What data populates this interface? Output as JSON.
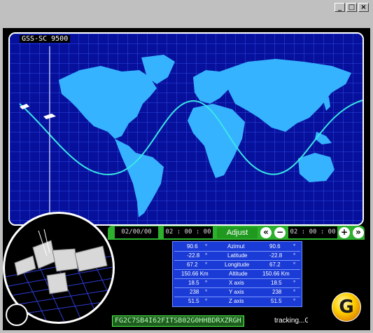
{
  "window": {
    "buttons": [
      "minimize",
      "maximize",
      "close"
    ]
  },
  "map": {
    "title": "GSS-SC 9500",
    "colors": {
      "ocean": "#06109a",
      "land": "#36b3ff",
      "grid": "#3a5cff",
      "orbit": "#39e6e6"
    }
  },
  "controls": {
    "date": "02/00/00",
    "time_left": "02 : 00 : 00",
    "adjust_label": "Adjust",
    "rewind_icon": "double-left-arrow",
    "minus_icon": "minus-circle",
    "time_right": "02 : 00 : 00",
    "plus_icon": "plus-circle",
    "forward_icon": "double-right-arrow"
  },
  "telemetry": [
    {
      "left": "90.6",
      "unit_left": "°",
      "label": "Azimut",
      "right": "90.6",
      "unit_right": "°"
    },
    {
      "left": "-22.8",
      "unit_left": "°",
      "label": "Latitude",
      "right": "-22.8",
      "unit_right": "°"
    },
    {
      "left": "67.2",
      "unit_left": "°",
      "label": "Longitude",
      "right": "67.2",
      "unit_right": "°"
    },
    {
      "left": "150.66 Km",
      "unit_left": "",
      "label": "Altitude",
      "right": "150.66 Km",
      "unit_right": ""
    },
    {
      "left": "18.5",
      "unit_left": "°",
      "label": "X axis",
      "right": "18.5",
      "unit_right": "°"
    },
    {
      "left": "238",
      "unit_left": "°",
      "label": "Y axis",
      "right": "238",
      "unit_right": "°"
    },
    {
      "left": "51.5",
      "unit_left": "°",
      "label": "Z axis",
      "right": "51.5",
      "unit_right": "°"
    }
  ],
  "status": {
    "code": "FG2C7SB4I62FITSB02G0HHBDRXZRGH",
    "tracking": "tracking...GSS-R"
  },
  "logo": {
    "letter": "G"
  }
}
